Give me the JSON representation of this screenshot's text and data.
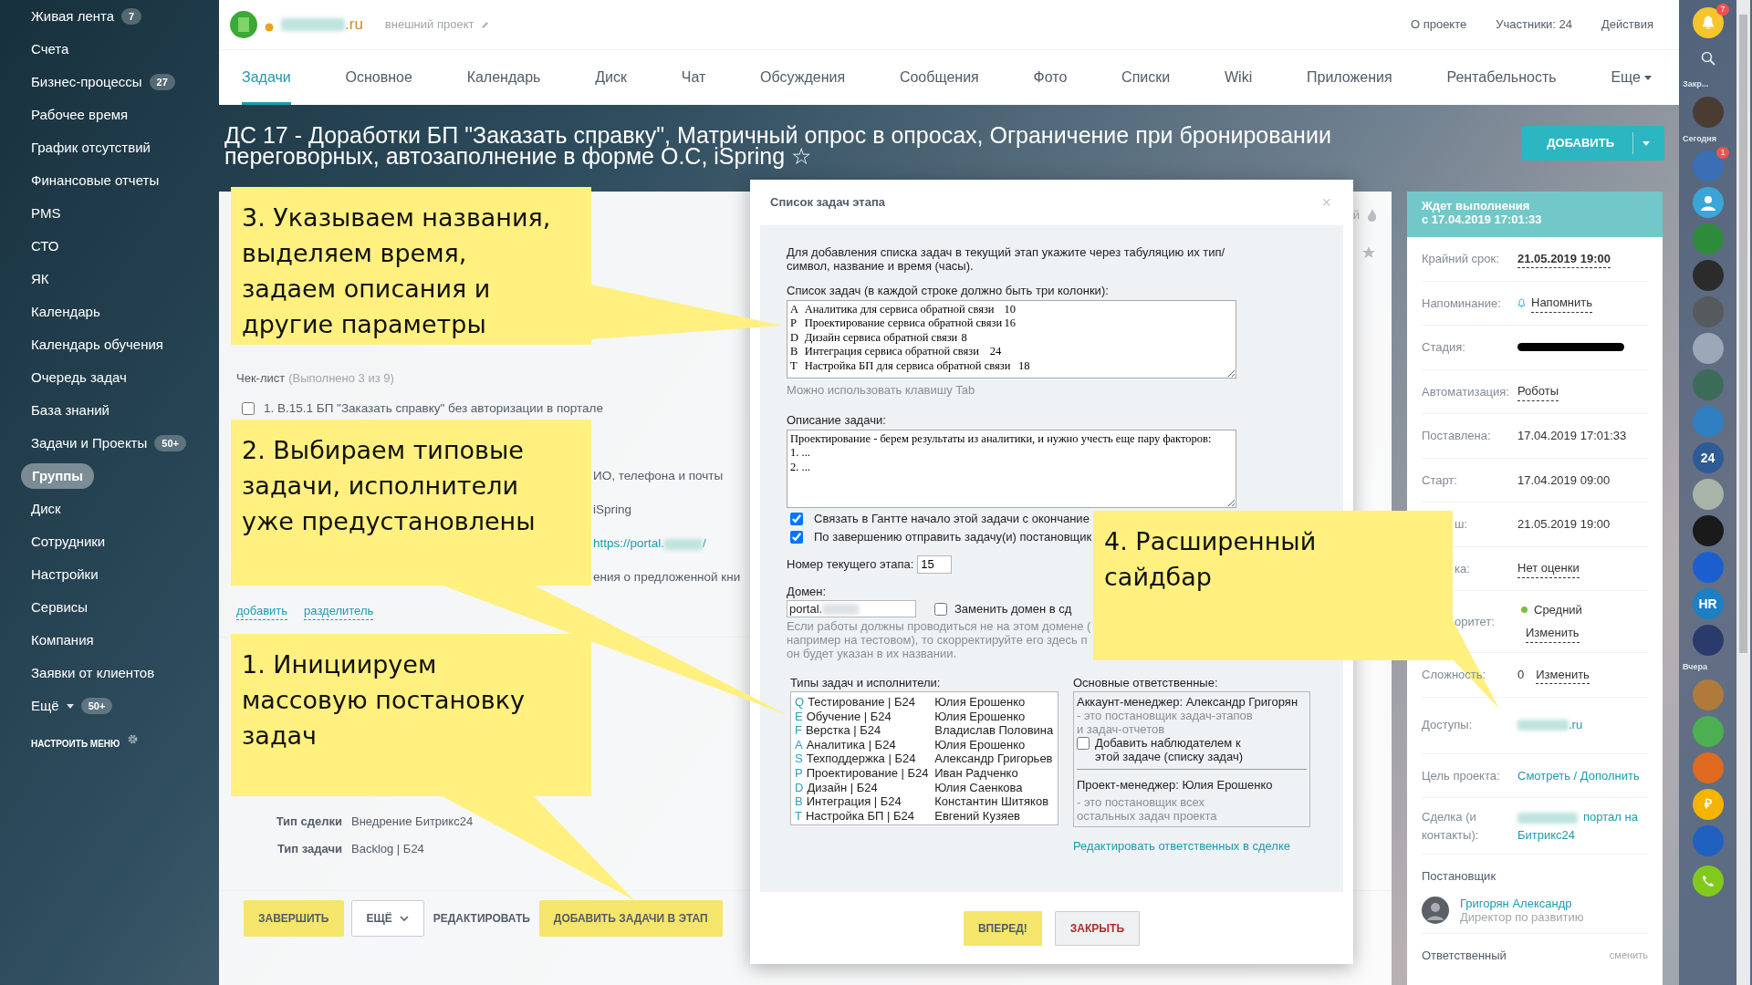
{
  "sidebar": {
    "items": [
      {
        "label": "Живая лента",
        "badge": "7",
        "selected": false
      },
      {
        "label": "Счета",
        "selected": false
      },
      {
        "label": "Бизнес-процессы",
        "badge": "27",
        "selected": false
      },
      {
        "label": "Рабочее время",
        "selected": false
      },
      {
        "label": "График отсутствий",
        "selected": false
      },
      {
        "label": "Финансовые отчеты",
        "selected": false
      },
      {
        "label": "PMS",
        "selected": false
      },
      {
        "label": "СТО",
        "selected": false
      },
      {
        "label": "ЯК",
        "selected": false
      },
      {
        "label": "Календарь",
        "selected": false
      },
      {
        "label": "Календарь обучения",
        "selected": false
      },
      {
        "label": "Очередь задач",
        "selected": false
      },
      {
        "label": "База знаний",
        "selected": false
      },
      {
        "label": "Задачи и Проекты",
        "badge": "50+",
        "selected": false
      },
      {
        "label": "Группы",
        "selected": true
      },
      {
        "label": "Диск",
        "selected": false
      },
      {
        "label": "Сотрудники",
        "selected": false
      },
      {
        "label": "Настройки",
        "selected": false
      },
      {
        "label": "Сервисы",
        "selected": false
      },
      {
        "label": "Компания",
        "selected": false
      },
      {
        "label": "Заявки от клиентов",
        "selected": false
      },
      {
        "label": "Ещё",
        "badge": "50+",
        "dropdown": true,
        "selected": false
      }
    ],
    "settings": "НАСТРОИТЬ МЕНЮ"
  },
  "header": {
    "site_suffix": ".ru",
    "project_type": "внешний проект",
    "links": [
      "О проекте",
      "Участники: 24",
      "Действия"
    ]
  },
  "tabs": [
    {
      "label": "Задачи",
      "selected": true
    },
    {
      "label": "Основное",
      "selected": false
    },
    {
      "label": "Календарь",
      "selected": false
    },
    {
      "label": "Диск",
      "selected": false
    },
    {
      "label": "Чат",
      "selected": false
    },
    {
      "label": "Обсуждения",
      "selected": false
    },
    {
      "label": "Сообщения",
      "selected": false
    },
    {
      "label": "Фото",
      "selected": false
    },
    {
      "label": "Списки",
      "selected": false
    },
    {
      "label": "Wiki",
      "selected": false
    },
    {
      "label": "Приложения",
      "selected": false
    },
    {
      "label": "Рентабельность",
      "selected": false
    },
    {
      "label": "Еще",
      "dropdown": true,
      "selected": false
    }
  ],
  "title": "ДС 17 - Доработки БП \"Заказать справку\", Матричный опрос в опросах, Ограничение при бронировании переговорных, автозаполнение в форме О.С, iSpring ☆",
  "add_button": "ДОБАВИТЬ",
  "task": {
    "corner_text": "й",
    "checklist": {
      "title": "Чек-лист",
      "summary": "(Выполнено 3 из 9)",
      "items": [
        {
          "text": "1. В.15.1 БП \"Заказать справку\" без авторизации в портале",
          "checked": false
        }
      ]
    },
    "partial_lines": [
      {
        "kind": "text",
        "text": "ИО, телефона и почты"
      },
      {
        "kind": "text",
        "text": "iSpring"
      },
      {
        "kind": "link",
        "text": "https://portal.",
        "tail": "/"
      },
      {
        "kind": "text",
        "text": "ения о предложенной кни"
      }
    ],
    "links": [
      "добавить",
      "разделитель"
    ],
    "fields": [
      {
        "label": "Тип сделки",
        "value": "Внедрение Битрикс24"
      },
      {
        "label": "Тип задачи",
        "value": "Backlog | Б24"
      }
    ],
    "buttons": [
      {
        "label": "ЗАВЕРШИТЬ",
        "kind": "primary"
      },
      {
        "label": "ЕЩЁ",
        "kind": "dropdown"
      },
      {
        "label": "РЕДАКТИРОВАТЬ",
        "kind": "link"
      },
      {
        "label": "ДОБАВИТЬ ЗАДАЧИ В ЭТАП",
        "kind": "primary"
      }
    ]
  },
  "modal": {
    "title": "Список задач этапа",
    "close": "×",
    "intro": "Для добавления списка задач в текущий этап укажите через табуляцию их тип/ символ, название и время (часы).",
    "tasks_label": "Список задач (в каждой строке должно быть три колонки):",
    "tasks": [
      {
        "type": "A",
        "name": "Аналитика для сервиса обратной связи",
        "hours": "10"
      },
      {
        "type": "P",
        "name": "Проектирование сервиса обратной связи",
        "hours": "16"
      },
      {
        "type": "D",
        "name": "Дизайн сервиса обратной связи",
        "hours": "8"
      },
      {
        "type": "B",
        "name": "Интеграция сервиса обратной связи",
        "hours": "24"
      },
      {
        "type": "T",
        "name": "Настройка БП для сервиса обратной связи",
        "hours": "18"
      }
    ],
    "tasks_hint": "Можно использовать клавишу Tab",
    "description_label": "Описание задачи:",
    "description": "Проектирование - берем результаты из аналитики, и нужно учесть еще пару факторов:\n1. ...\n2. ...",
    "options": [
      {
        "label": "Связать в Гантте начало этой задачи с окончание",
        "checked": true
      },
      {
        "label": "По завершению отправить задачу(и) постановщик",
        "checked": true
      }
    ],
    "stage_label": "Номер текущего этапа:",
    "stage_value": "15",
    "domain_label": "Домен:",
    "domain_value": "portal.",
    "replace_domain": {
      "label": "Заменить домен в сд",
      "checked": false
    },
    "domain_hint": "Если работы должны проводиться не на этом домене (\nнапример на тестовом), то скорректируйте его здесь п\nон будет указан в их названии.",
    "types_label": "Типы задач и исполнители:",
    "types": [
      {
        "letter": "Q",
        "name": "Тестирование | Б24",
        "assignee": "Юлия Ерошенко"
      },
      {
        "letter": "E",
        "name": "Обучение | Б24",
        "assignee": "Юлия Ерошенко"
      },
      {
        "letter": "F",
        "name": "Верстка | Б24",
        "assignee": "Владислав Половина"
      },
      {
        "letter": "A",
        "name": "Аналитика | Б24",
        "assignee": "Юлия Ерошенко"
      },
      {
        "letter": "S",
        "name": "Техподдержка | Б24",
        "assignee": "Александр Григорьев"
      },
      {
        "letter": "P",
        "name": "Проектирование | Б24",
        "assignee": "Иван Радченко"
      },
      {
        "letter": "D",
        "name": "Дизайн | Б24",
        "assignee": "Юлия Саенкова"
      },
      {
        "letter": "B",
        "name": "Интеграция | Б24",
        "assignee": "Константин Шитяков"
      },
      {
        "letter": "T",
        "name": "Настройка БП | Б24",
        "assignee": "Евгений Кузяев"
      }
    ],
    "resp_label": "Основные ответственные:",
    "account": {
      "role": "Аккаунт-менеджер:",
      "name": "Александр Григорян",
      "note": "- это постановщик задач-этапов\nи задач-отчетов"
    },
    "watcher": {
      "label": "Добавить наблюдателем к\nэтой задаче (списку задач)",
      "checked": false
    },
    "project": {
      "role": "Проект-менеджер:",
      "name": "Юлия Ерошенко",
      "note": "- это постановщик всех\nостальных задач проекта"
    },
    "edit_link": "Редактировать ответственных в сделке",
    "buttons": [
      {
        "label": "ВПЕРЕД!",
        "kind": "primary"
      },
      {
        "label": "ЗАКРЫТЬ",
        "kind": "cancel"
      }
    ]
  },
  "right_panel": {
    "status": "Ждет выполнения",
    "since": "с 17.04.2019 17:01:33",
    "rows": [
      {
        "kind": "dashed",
        "label": "Крайний срок:",
        "value": "21.05.2019 19:00",
        "bold": true
      },
      {
        "kind": "reminder",
        "label": "Напоминание:",
        "value": "Напомнить"
      },
      {
        "kind": "stage",
        "label": "Стадия:"
      },
      {
        "kind": "dashed",
        "label": "Автоматизация:",
        "value": "Роботы"
      },
      {
        "kind": "plain",
        "label": "Поставлена:",
        "value": "17.04.2019 17:01:33"
      },
      {
        "kind": "plain",
        "label": "Старт:",
        "value": "17.04.2019 09:00"
      },
      {
        "kind": "plain",
        "label": "ш:",
        "value": "21.05.2019 19:00",
        "cut": true
      },
      {
        "kind": "dashed",
        "label": "ка:",
        "value": "Нет оценки",
        "cut": true
      },
      {
        "kind": "priority",
        "label": "оритет:",
        "value": "Средний",
        "color": "#7bbf3a",
        "action": "Изменить",
        "cut": true
      },
      {
        "kind": "complexity",
        "label": "Сложность:",
        "value": "0",
        "action": "Изменить"
      },
      {
        "kind": "access",
        "label": "Доступы:",
        "value": ".ru"
      },
      {
        "kind": "link",
        "label": "Цель проекта:",
        "value": "Смотреть / Дополнить"
      },
      {
        "kind": "deal",
        "label": "Сделка (и контакты):",
        "value": "портал на Битрикс24"
      }
    ],
    "creator": {
      "title": "Постановщик",
      "name": "Григорян Александр",
      "role": "Директор по развитию"
    },
    "responsible": {
      "title": "Ответственный",
      "action": "сменить"
    }
  },
  "right_bar": [
    {
      "kind": "bell",
      "badge": "7"
    },
    {
      "kind": "search"
    },
    {
      "kind": "label",
      "text": "Закр..."
    },
    {
      "kind": "avatar",
      "color": "#4a3b33"
    },
    {
      "kind": "label",
      "text": "Сегодня"
    },
    {
      "kind": "avatar",
      "color": "#3a6fb5",
      "badge": "1"
    },
    {
      "kind": "user",
      "color": "#3aa6d8"
    },
    {
      "kind": "avatar",
      "color": "#2e8b3a"
    },
    {
      "kind": "avatar",
      "color": "#2b2b2b"
    },
    {
      "kind": "avatar",
      "color": "#555a5e"
    },
    {
      "kind": "avatar",
      "color": "#9aa8b8"
    },
    {
      "kind": "avatar",
      "color": "#3d6b5a"
    },
    {
      "kind": "avatar",
      "color": "#2f7fc1"
    },
    {
      "kind": "avatar",
      "color": "#2d5b96",
      "text": "24"
    },
    {
      "kind": "avatar",
      "color": "#a8b4a8"
    },
    {
      "kind": "avatar",
      "color": "#1a1a1a"
    },
    {
      "kind": "avatar",
      "color": "#1b5fcf"
    },
    {
      "kind": "avatar",
      "color": "#1d7fc4",
      "text": "HR"
    },
    {
      "kind": "avatar",
      "color": "#2a3a6a"
    },
    {
      "kind": "label",
      "text": "Вчера"
    },
    {
      "kind": "avatar",
      "color": "#b07a3a"
    },
    {
      "kind": "avatar",
      "color": "#4caf50"
    },
    {
      "kind": "avatar",
      "color": "#e06a20"
    },
    {
      "kind": "avatar",
      "color": "#f4b400",
      "text": "₽"
    },
    {
      "kind": "avatar",
      "color": "#2060c0"
    },
    {
      "kind": "phone"
    }
  ],
  "callouts": [
    {
      "text": "3. Указываем названия,\nвыделяем время,\nзадаем описания и\nдругие параметры"
    },
    {
      "text": "2. Выбираем типовые\nзадачи, исполнители\nуже предустановлены"
    },
    {
      "text": "1. Инициируем\nмассовую постановку\nзадач"
    },
    {
      "text": "4. Расширенный\nсайдбар"
    }
  ]
}
